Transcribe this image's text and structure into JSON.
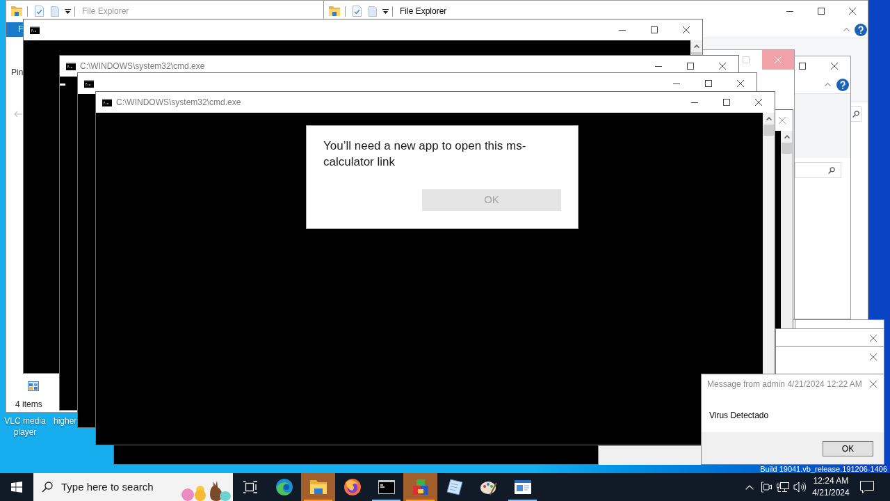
{
  "desktop": {
    "icons": [
      {
        "label": "VLC media player"
      },
      {
        "label": "higher"
      }
    ],
    "build_text": "Build 19041.vb_release.191206-1406"
  },
  "explorer_windows": [
    {
      "title": "File Explorer",
      "active": false,
      "ribbon_tab": "F",
      "pane_label": "Pin",
      "status": "4 items"
    },
    {
      "title": "File Explorer",
      "active": true
    }
  ],
  "side_windows": [
    {
      "close_hovered": true
    },
    {
      "close_hovered": false
    }
  ],
  "console_windows": [
    {
      "cursor": false
    },
    {
      "title": "C:\\WINDOWS\\system32\\cmd.exe",
      "cursor": true
    },
    {
      "cursor": false
    },
    {
      "title": "C:\\WINDOWS\\system32\\cmd.exe",
      "cursor": false
    },
    {
      "cursor": false
    }
  ],
  "app_dialog": {
    "message": "You’ll need a new app to open this ms-calculator link",
    "button": {
      "label": "OK",
      "disabled": true
    }
  },
  "message_box": {
    "title": "Message from admin 4/21/2024 12:22 AM",
    "message": "Virus Detectado",
    "button": "OK"
  },
  "taskbar": {
    "search": {
      "placeholder": "Type here to search"
    },
    "apps": [
      {
        "kind": "swirl",
        "running": false,
        "flashing": false
      },
      {
        "kind": "folder",
        "running": true,
        "flashing": true
      },
      {
        "kind": "flame",
        "running": false,
        "flashing": false
      },
      {
        "kind": "terminal",
        "running": true,
        "flashing": false
      },
      {
        "kind": "blocks",
        "running": true,
        "flashing": true
      },
      {
        "kind": "page",
        "running": false,
        "flashing": false
      },
      {
        "kind": "palette",
        "running": false,
        "flashing": false
      },
      {
        "kind": "window",
        "running": true,
        "flashing": false
      }
    ],
    "clock": {
      "time": "12:24 AM",
      "date": "4/21/2024"
    }
  }
}
